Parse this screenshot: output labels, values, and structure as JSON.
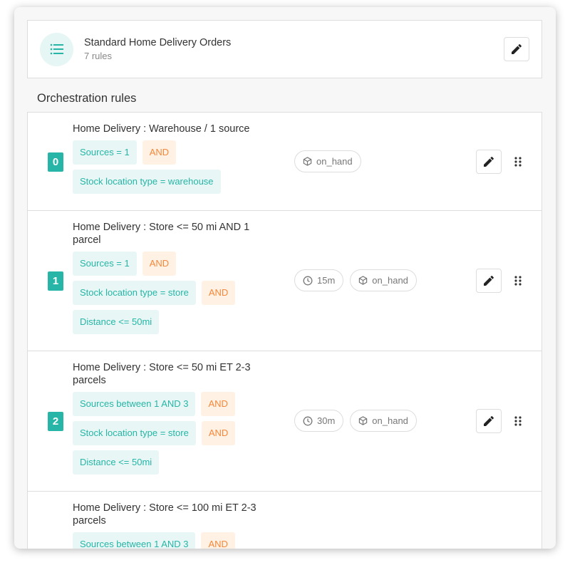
{
  "header": {
    "title": "Standard Home Delivery Orders",
    "subtitle": "7 rules",
    "icon": "list-icon",
    "edit_icon": "pencil-icon"
  },
  "section_title": "Orchestration rules",
  "colors": {
    "accent": "#26b5a6",
    "accent_bg": "#e8f7f5",
    "and_text": "#f5883a",
    "and_bg": "#fff1e3"
  },
  "rules": [
    {
      "index": "0",
      "title": "Home Delivery : Warehouse / 1 source",
      "conditions": [
        {
          "text": "Sources = 1",
          "op": "AND"
        },
        {
          "text": "Stock location type = warehouse"
        }
      ],
      "chips": [
        {
          "icon": "box-icon",
          "label": "on_hand"
        }
      ]
    },
    {
      "index": "1",
      "title": "Home Delivery : Store <= 50 mi AND 1 parcel",
      "conditions": [
        {
          "text": "Sources = 1",
          "op": "AND"
        },
        {
          "text": "Stock location type = store",
          "op": "AND"
        },
        {
          "text": "Distance <= 50mi"
        }
      ],
      "chips": [
        {
          "icon": "clock-icon",
          "label": "15m"
        },
        {
          "icon": "box-icon",
          "label": "on_hand"
        }
      ]
    },
    {
      "index": "2",
      "title": "Home Delivery : Store <= 50 mi ET 2-3 parcels",
      "conditions": [
        {
          "text": "Sources between 1 AND 3",
          "op": "AND"
        },
        {
          "text": "Stock location type = store",
          "op": "AND"
        },
        {
          "text": "Distance <= 50mi"
        }
      ],
      "chips": [
        {
          "icon": "clock-icon",
          "label": "30m"
        },
        {
          "icon": "box-icon",
          "label": "on_hand"
        }
      ]
    },
    {
      "index": "",
      "title": "Home Delivery : Store <= 100 mi ET 2-3 parcels",
      "conditions": [
        {
          "text": "Sources between 1 AND 3",
          "op": "AND"
        }
      ],
      "chips": []
    }
  ]
}
